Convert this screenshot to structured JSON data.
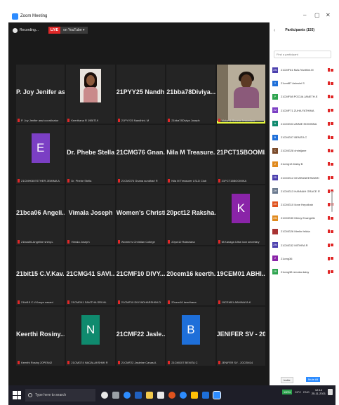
{
  "window": {
    "title": "Zoom Meeting",
    "minimize": "–",
    "maximize": "▢",
    "close": "✕"
  },
  "topbar": {
    "recording": "Recording...",
    "live": "LIVE",
    "live_target": "on YouTube ▾"
  },
  "tiles": [
    {
      "big": "P. Joy Jenifer as...",
      "label": "P. Joy Jenifer asst coordinator",
      "kind": "text"
    },
    {
      "big": "",
      "label": "Keerthana R 19BIT19",
      "kind": "photo"
    },
    {
      "big": "21PYY25 Nandh...",
      "label": "21PYY25 Nandhini. M",
      "kind": "text"
    },
    {
      "big": "21bba78Diviya...",
      "label": "21bba78Diviya Joseph",
      "kind": "text"
    },
    {
      "big": "",
      "label": "Victor & Sheela Jessadass",
      "kind": "video"
    },
    {
      "big": "E",
      "label": "21CMH08 ESTHER JEMIMA A",
      "kind": "avatar",
      "color": "#7b3fc4"
    },
    {
      "big": "Dr. Phebe Stella",
      "label": "Dr. Phebe Stella",
      "kind": "text"
    },
    {
      "big": "21CMG76 Gnan...",
      "label": "21CMG76 Gnana sundhari R",
      "kind": "text"
    },
    {
      "big": "Nila M Treasure...",
      "label": "Nila M Treasurer LSLD Club",
      "kind": "text"
    },
    {
      "big": "21PCT15BOOMI...",
      "label": "21PCT15BOOMIKA",
      "kind": "text"
    },
    {
      "big": "21bca06 Angeli...",
      "label": "21bca06-Angeline shiny.L",
      "kind": "text"
    },
    {
      "big": "Vimala Joseph",
      "label": "Vimala Joseph",
      "kind": "text"
    },
    {
      "big": "Women's Christi...",
      "label": "Women's Christian College",
      "kind": "text"
    },
    {
      "big": "20pct12 Raksha...",
      "label": "20pct12 Rakshana",
      "kind": "text"
    },
    {
      "big": "K",
      "label": "M.Kanaga Ultra Icon secretary",
      "kind": "avatar",
      "color": "#8a24a8"
    },
    {
      "big": "21bit15 C.V.Kav...",
      "label": "21bit15 C.V.Kavya nasani",
      "kind": "text"
    },
    {
      "big": "21CMG41 SAVI...",
      "label": "21CMG41 SAVITHA SRI.ML",
      "kind": "text"
    },
    {
      "big": "21CMF10 DIVY...",
      "label": "21CMF10 DIVYADHARSHINI.D",
      "kind": "text"
    },
    {
      "big": "20cem16 keerth...",
      "label": "20cem16 keerthana",
      "kind": "text"
    },
    {
      "big": "19CEM01 ABHI...",
      "label": "19CEM01 ABHINAYA K",
      "kind": "text"
    },
    {
      "big": "Keerthi Rosiny...",
      "label": "Keerthi Rosiny 20PEN42",
      "kind": "text"
    },
    {
      "big": "N",
      "label": "21CMG74 NAGALAKSHMI R",
      "kind": "avatar",
      "color": "#0f8a6e"
    },
    {
      "big": "21CMF22 Jasle...",
      "label": "21CMF22 Jasleine Canas A",
      "kind": "text"
    },
    {
      "big": "B",
      "label": "21CMG07 BENITA C",
      "kind": "avatar",
      "color": "#1e6fd9"
    },
    {
      "big": "JENIFER SV - 20...",
      "label": "JENIFER SV - 20CEM14",
      "kind": "text"
    }
  ],
  "panel": {
    "back": "‹",
    "title": "Participants (155)",
    "search_placeholder": "Find a participant",
    "participants": [
      {
        "initials": "2M",
        "name": "21CMF61 MALIYanthini.M",
        "color": "#4b3fae"
      },
      {
        "initials": "2",
        "name": "21cmf87 Ashwini S",
        "color": "#1e6fd9"
      },
      {
        "initials": "P",
        "name": "21CMF08 POOJA JANETH.E",
        "color": "#2ea44f"
      },
      {
        "initials": "2Z",
        "name": "21CMF71 ZUHA FATHIMA",
        "color": "#7b3fc4"
      },
      {
        "initials": "A",
        "name": "21CMG03 ANNIE EDWINNA",
        "color": "#0f8a6e"
      },
      {
        "initials": "B",
        "name": "21CMG07 BENITA C",
        "color": "#1e6fd9"
      },
      {
        "initials": "C",
        "name": "21CMG28 christjane",
        "color": "#7a4a2a"
      },
      {
        "initials": "2",
        "name": "21cmg13 Daisy B",
        "color": "#e08a1e"
      },
      {
        "initials": "2D",
        "name": "21CMG12 DHARANEESWARI R",
        "color": "#4b3fae"
      },
      {
        "initials": "2H",
        "name": "21CMG13 HANNAH GRACE SWE...",
        "color": "#6b7a8f"
      },
      {
        "initials": "2H",
        "name": "21CMG10 Ilone Hepzibah",
        "color": "#e0531e"
      },
      {
        "initials": "2M",
        "name": "21CMG30 Mercy Evangelin",
        "color": "#e08a1e"
      },
      {
        "initials": "",
        "name": "21CMG26 Merlin felicia",
        "color": "#a83232"
      },
      {
        "initials": "2M",
        "name": "21CMG32 MITHRA R",
        "color": "#4b3fae"
      },
      {
        "initials": "2",
        "name": "21cmg36",
        "color": "#8a24a8"
      },
      {
        "initials": "2R",
        "name": "21cmg38 renuka daisy",
        "color": "#2ea44f"
      }
    ],
    "invite": "Invite",
    "mute_all": "Mute All"
  },
  "taskbar": {
    "search_placeholder": "Type here to search",
    "battery": "100%",
    "temp": "26°C",
    "lang": "ENG",
    "time": "12:14",
    "date": "25-11-2021"
  }
}
